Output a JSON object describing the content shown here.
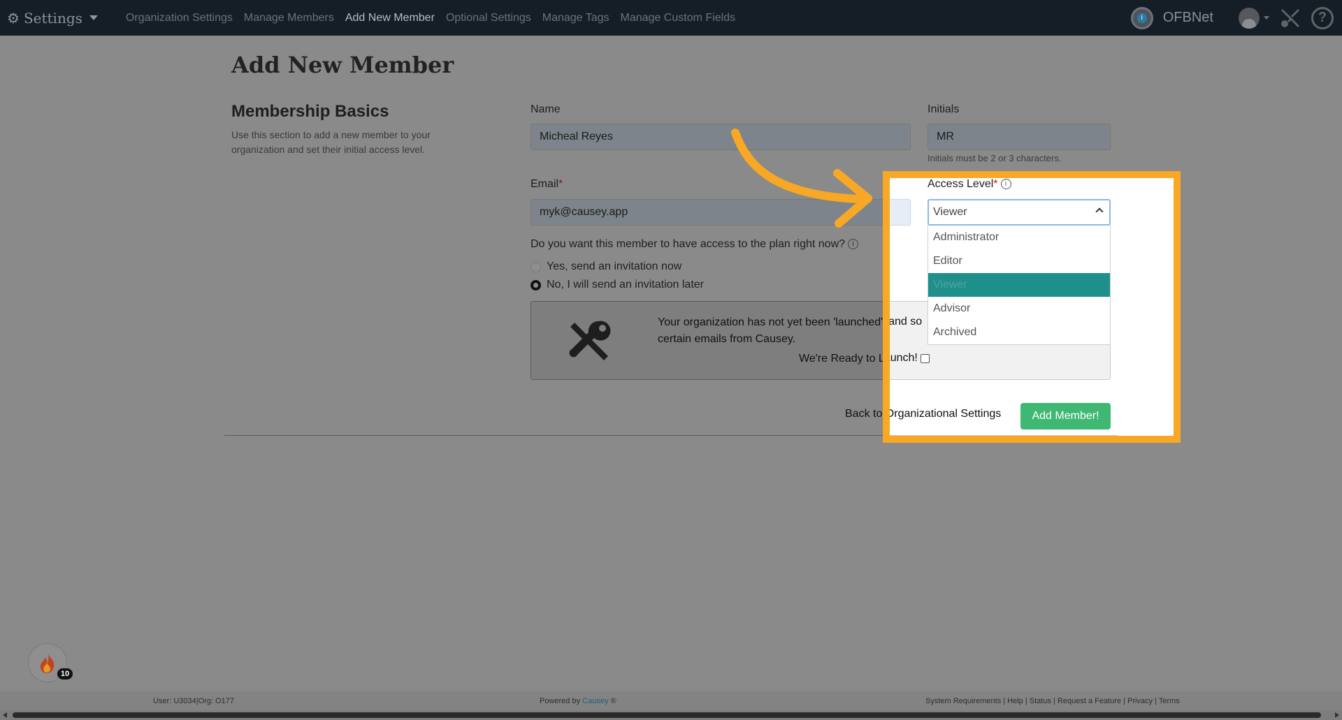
{
  "nav": {
    "brand": "Settings",
    "links": [
      {
        "label": "Organization Settings"
      },
      {
        "label": "Manage Members"
      },
      {
        "label": "Add New Member"
      },
      {
        "label": "Optional Settings"
      },
      {
        "label": "Manage Tags"
      },
      {
        "label": "Manage Custom Fields"
      }
    ],
    "active_link": "Add New Member",
    "org_name": "OFBNet",
    "org_icon": "info-circle-icon",
    "help_icon": "question-circle-icon",
    "tools_icon": "wrench-screwdriver-icon",
    "help_glyph": "?"
  },
  "page": {
    "title": "Add New Member",
    "section_title": "Membership Basics",
    "section_desc": "Use this section to add a new member to your organization and set their initial access level."
  },
  "form": {
    "name_label": "Name",
    "name_value": "Micheal Reyes",
    "initials_label": "Initials",
    "initials_value": "MR",
    "initials_help": "Initials must be 2 or 3 characters.",
    "email_label": "Email",
    "email_value": "myk@causey.app",
    "required_mark": "*",
    "access_label": "Access Level",
    "access_value": "Viewer",
    "access_options": [
      "Administrator",
      "Editor",
      "Viewer",
      "Advisor",
      "Archived"
    ],
    "access_selected": "Viewer",
    "invite_question": "Do you want this member to have access to the plan right now?",
    "invite_options": [
      {
        "label": "Yes, send an invitation now",
        "checked": false
      },
      {
        "label": "No, I will send an invitation later",
        "checked": true
      }
    ],
    "info_glyph": "i"
  },
  "launch": {
    "message_line1": "Your organization has not yet been 'launched', and so",
    "message_line2": "certain emails from Causey.",
    "ready_label": "We're Ready to Launch!",
    "icon": "tools-icon"
  },
  "actions": {
    "back_label": "Back to Organizational Settings",
    "add_label": "Add Member!"
  },
  "floating": {
    "icon": "fire-icon",
    "count": "10"
  },
  "footer": {
    "user_info": "User: U3034|Org: O177",
    "powered_prefix": "Powered by",
    "powered_link": "Causey",
    "powered_suffix": "®",
    "links": "System Requirements | Help | Status | Request a Feature | Privacy | Terms"
  },
  "colors": {
    "highlight": "#f9a825",
    "add_button": "#3fb873",
    "selected_option": "#1e8f8a"
  }
}
